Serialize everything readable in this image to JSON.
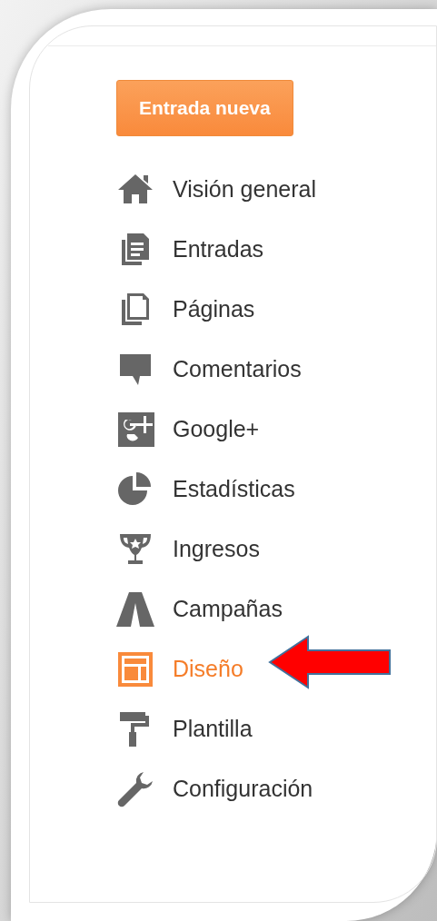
{
  "new_post_button": {
    "label": "Entrada nueva"
  },
  "nav": {
    "items": [
      {
        "label": "Visión general",
        "selected": false
      },
      {
        "label": "Entradas",
        "selected": false
      },
      {
        "label": "Páginas",
        "selected": false
      },
      {
        "label": "Comentarios",
        "selected": false
      },
      {
        "label": "Google+",
        "selected": false
      },
      {
        "label": "Estadísticas",
        "selected": false
      },
      {
        "label": "Ingresos",
        "selected": false
      },
      {
        "label": "Campañas",
        "selected": false
      },
      {
        "label": "Diseño",
        "selected": true
      },
      {
        "label": "Plantilla",
        "selected": false
      },
      {
        "label": "Configuración",
        "selected": false
      }
    ]
  }
}
